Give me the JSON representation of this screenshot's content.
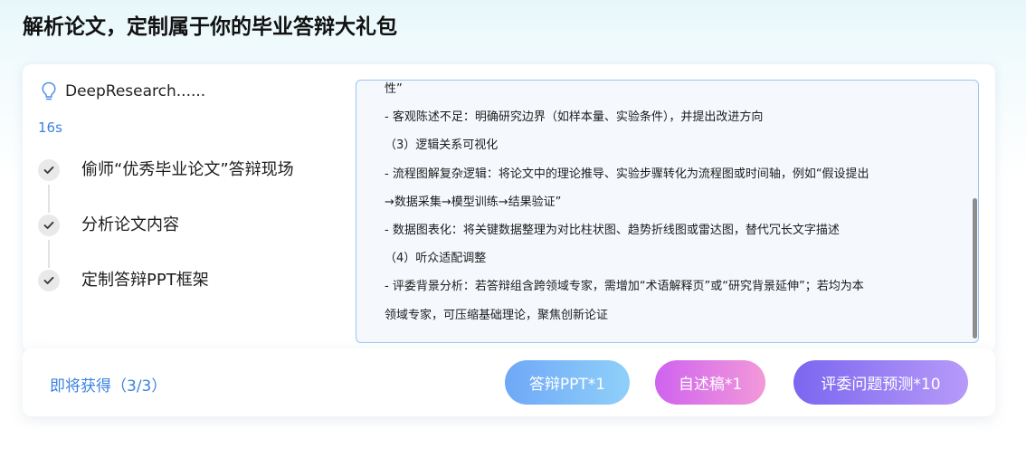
{
  "page": {
    "title": "解析论文，定制属于你的毕业答辩大礼包"
  },
  "status": {
    "icon": "lightbulb-icon",
    "text": "DeepResearch......",
    "elapsed": "16s"
  },
  "steps": [
    {
      "label": "偷师“优秀毕业论文”答辩现场",
      "done": true
    },
    {
      "label": "分析论文内容",
      "done": true
    },
    {
      "label": "定制答辩PPT框架",
      "done": true
    }
  ],
  "content": {
    "lines": [
      "性”",
      "- 客观陈述不足：明确研究边界（如样本量、实验条件），并提出改进方向",
      "（3）逻辑关系可视化",
      "- 流程图解复杂逻辑：将论文中的理论推导、实验步骤转化为流程图或时间轴，例如“假设提出",
      "→数据采集→模型训练→结果验证”",
      "- 数据图表化：将关键数据整理为对比柱状图、趋势折线图或雷达图，替代冗长文字描述",
      "（4）听众适配调整",
      "- 评委背景分析：若答辩组含跨领域专家，需增加“术语解释页”或“研究背景延伸”；若均为本",
      "领域专家，可压缩基础理论，聚焦创新论证"
    ]
  },
  "bottom": {
    "obtain_label": "即将获得（3/3）",
    "buttons": {
      "ppt": "答辩PPT*1",
      "speech": "自述稿*1",
      "questions": "评委问题预测*10"
    }
  },
  "colors": {
    "accent_blue": "#3b82e0",
    "ppt_gradient": [
      "#6fa8f7",
      "#8fd0f9"
    ],
    "speech_gradient": [
      "#cf63ef",
      "#f299d9"
    ],
    "questions_gradient": [
      "#7b66f0",
      "#b79af8"
    ]
  }
}
